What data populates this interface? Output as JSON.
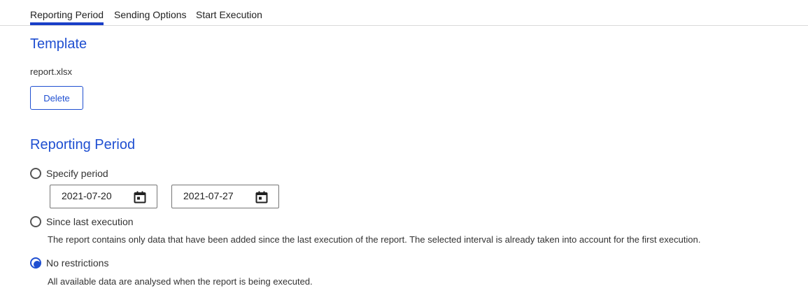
{
  "tabs": [
    {
      "label": "Reporting Period",
      "active": true
    },
    {
      "label": "Sending Options",
      "active": false
    },
    {
      "label": "Start Execution",
      "active": false
    }
  ],
  "template": {
    "title": "Template",
    "filename": "report.xlsx",
    "delete_label": "Delete"
  },
  "reporting_period": {
    "title": "Reporting Period",
    "options": [
      {
        "label": "Specify period",
        "checked": false
      },
      {
        "label": "Since last execution",
        "checked": false,
        "description": "The report contains only data that have been added since the last execution of the report. The selected interval is already taken into account for the first execution."
      },
      {
        "label": "No restrictions",
        "checked": true,
        "description": "All available data are analysed when the report is being executed."
      }
    ],
    "start_date": "2021-07-20",
    "end_date": "2021-07-27"
  },
  "icons": {
    "calendar": "calendar-icon"
  },
  "colors": {
    "accent": "#1f4fd1",
    "tab_underline": "#1a3fc8"
  }
}
